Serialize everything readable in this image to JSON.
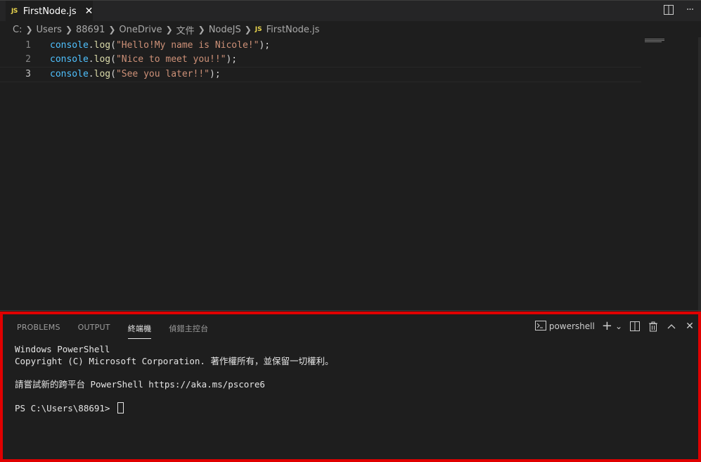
{
  "tab": {
    "badge": "JS",
    "name": "FirstNode.js",
    "close": "✕"
  },
  "tab_actions": {
    "split_icon": "split-editor-icon",
    "more_label": "···"
  },
  "breadcrumb": [
    "C:",
    "Users",
    "88691",
    "OneDrive",
    "文件",
    "NodeJS",
    "FirstNode.js"
  ],
  "breadcrumb_js_badge": "JS",
  "editor": {
    "lines": [
      {
        "num": "1",
        "obj": "console",
        "dot": ".",
        "fn": "log",
        "open": "(",
        "str": "\"Hello!My name is Nicole!\"",
        "close": ");"
      },
      {
        "num": "2",
        "obj": "console",
        "dot": ".",
        "fn": "log",
        "open": "(",
        "str": "\"Nice to meet you!!\"",
        "close": ");"
      },
      {
        "num": "3",
        "obj": "console",
        "dot": ".",
        "fn": "log",
        "open": "(",
        "str": "\"See you later!!\"",
        "close": ");"
      }
    ]
  },
  "panel": {
    "tabs": [
      "PROBLEMS",
      "OUTPUT",
      "終端機",
      "偵錯主控台"
    ],
    "active_tab": "終端機",
    "shell_label": "powershell",
    "add_label": "+",
    "dropdown_label": "⌄",
    "close_label": "✕"
  },
  "terminal": {
    "line1": "Windows PowerShell",
    "line2": "Copyright (C) Microsoft Corporation. 著作權所有，並保留一切權利。",
    "line3": "",
    "line4": "請嘗試新的跨平台 PowerShell https://aka.ms/pscore6",
    "line5": "",
    "prompt": "PS C:\\Users\\88691> "
  },
  "colors": {
    "highlight_border": "#e00000",
    "string": "#ce9178",
    "function": "#dcdcaa",
    "object": "#4fc1ff"
  }
}
